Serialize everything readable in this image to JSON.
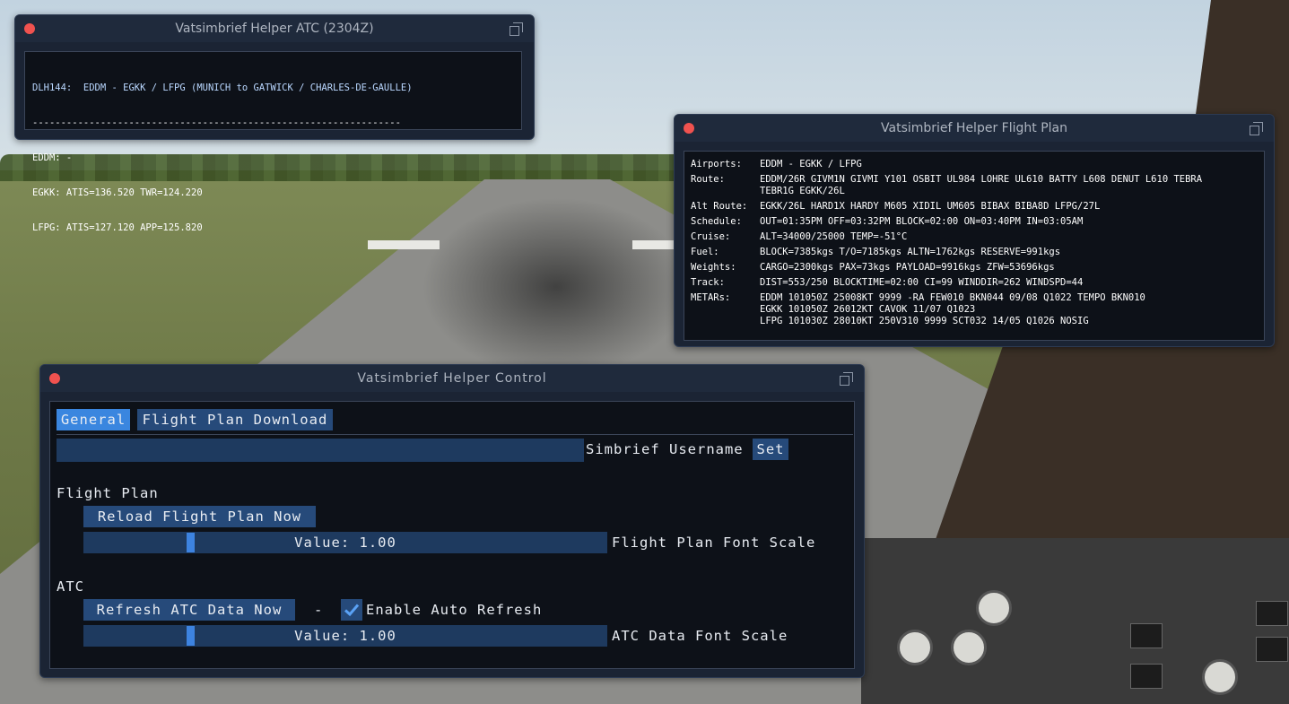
{
  "atc_window": {
    "title": "Vatsimbrief Helper ATC (2304Z)",
    "header_line": "DLH144:  EDDM - EGKK / LFPG (MUNICH to GATWICK / CHARLES-DE-GAULLE)",
    "separator": "-----------------------------------------------------------------",
    "lines": [
      "EDDM: -",
      "EGKK: ATIS=136.520 TWR=124.220",
      "LFPG: ATIS=127.120 APP=125.820"
    ]
  },
  "flightplan_window": {
    "title": "Vatsimbrief Helper Flight Plan",
    "rows": [
      {
        "label": "Airports:",
        "value": "EDDM - EGKK / LFPG"
      },
      {
        "label": "Route:",
        "value": "EDDM/26R GIVM1N GIVMI Y101 OSBIT UL984 LOHRE UL610 BATTY L608 DENUT L610 TEBRA\nTEBR1G EGKK/26L"
      },
      {
        "label": "Alt Route:",
        "value": "EGKK/26L HARD1X HARDY M605 XIDIL UM605 BIBAX BIBA8D LFPG/27L"
      },
      {
        "label": "Schedule:",
        "value": "OUT=01:35PM OFF=03:32PM BLOCK=02:00 ON=03:40PM IN=03:05AM"
      },
      {
        "label": "Cruise:",
        "value": "ALT=34000/25000 TEMP=-51°C"
      },
      {
        "label": "Fuel:",
        "value": "BLOCK=7385kgs T/O=7185kgs ALTN=1762kgs RESERVE=991kgs"
      },
      {
        "label": "Weights:",
        "value": "CARGO=2300kgs PAX=73kgs PAYLOAD=9916kgs ZFW=53696kgs"
      },
      {
        "label": "Track:",
        "value": "DIST=553/250 BLOCKTIME=02:00 CI=99 WINDDIR=262 WINDSPD=44"
      },
      {
        "label": "METARs:",
        "value": "EDDM 101050Z 25008KT 9999 -RA FEW010 BKN044 09/08 Q1022 TEMPO BKN010\nEGKK 101050Z 26012KT CAVOK 11/07 Q1023\nLFPG 101030Z 28010KT 250V310 9999 SCT032 14/05 Q1026 NOSIG"
      }
    ]
  },
  "control_window": {
    "title": "Vatsimbrief Helper Control",
    "tabs": [
      "General",
      "Flight Plan Download"
    ],
    "username_label": "Simbrief Username",
    "username_value": "",
    "set_label": "Set",
    "flight_plan_section": "Flight Plan",
    "reload_button": "Reload Flight Plan Now",
    "fp_slider_value": "Value: 1.00",
    "fp_slider_fraction": 0.2,
    "fp_font_scale_label": "Flight Plan Font Scale",
    "atc_section": "ATC",
    "refresh_button": "Refresh ATC Data Now",
    "dash": "-",
    "auto_refresh_label": "Enable Auto Refresh",
    "auto_refresh_checked": true,
    "atc_slider_value": "Value: 1.00",
    "atc_slider_fraction": 0.2,
    "atc_font_scale_label": "ATC Data Font Scale"
  },
  "colors": {
    "accent": "#3a86df",
    "button": "#264a7a",
    "close_dot": "#f0524f"
  }
}
